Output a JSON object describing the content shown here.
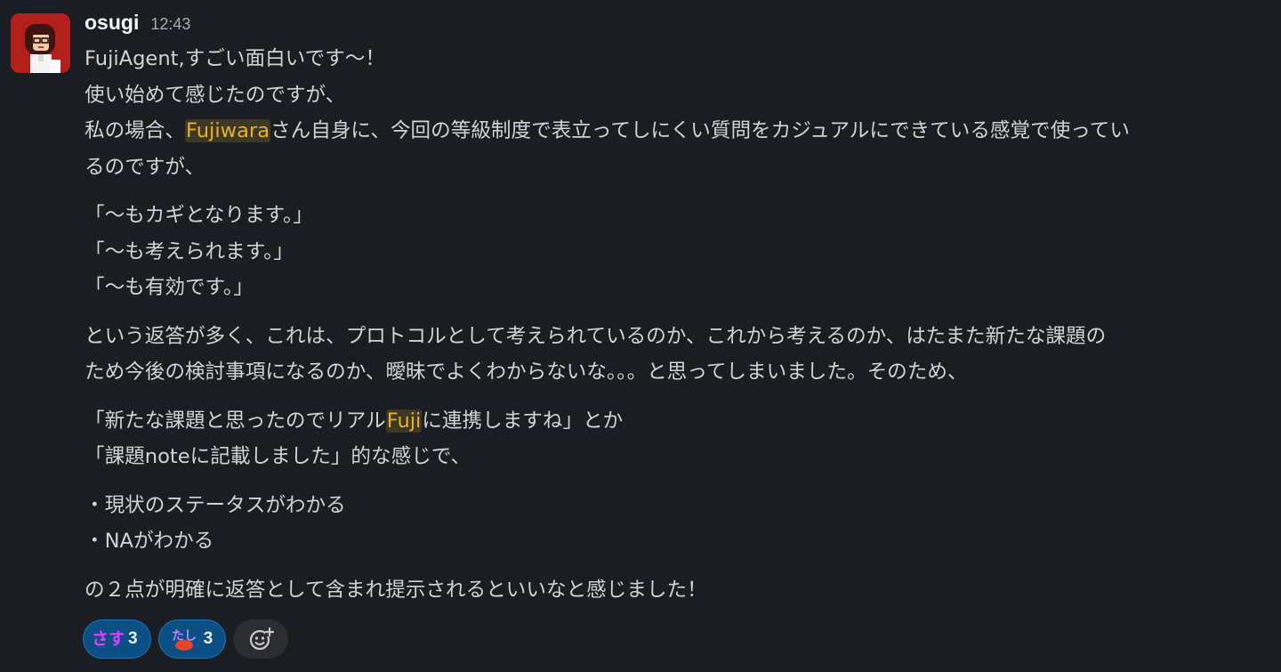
{
  "message": {
    "author": "osugi",
    "time": "12:43",
    "paragraphs": [
      [
        [
          {
            "t": "FujiAgent,すごい面白いです〜！"
          }
        ],
        [
          {
            "t": "使い始めて感じたのですが、"
          }
        ],
        [
          {
            "t": "私の場合、"
          },
          {
            "t": "Fujiwara",
            "mention": true
          },
          {
            "t": "さん自身に、今回の等級制度で表立ってしにくい質問をカジュアルにできている感覚で使ってい"
          }
        ],
        [
          {
            "t": "るのですが、"
          }
        ]
      ],
      [
        [
          {
            "t": "「〜もカギとなります。」"
          }
        ],
        [
          {
            "t": "「〜も考えられます。」"
          }
        ],
        [
          {
            "t": "「〜も有効です。」"
          }
        ]
      ],
      [
        [
          {
            "t": "という返答が多く、これは、プロトコルとして考えられているのか、これから考えるのか、はたまた新たな課題の"
          }
        ],
        [
          {
            "t": "ため今後の検討事項になるのか、曖昧でよくわからないな。。。と思ってしまいました。そのため、"
          }
        ]
      ],
      [
        [
          {
            "t": "「新たな課題と思ったのでリアル"
          },
          {
            "t": "Fuji",
            "mention": true
          },
          {
            "t": "に連携しますね」とか"
          }
        ],
        [
          {
            "t": "「課題noteに記載しました」的な感じで、"
          }
        ]
      ],
      [
        [
          {
            "t": "・現状のステータスがわかる"
          }
        ],
        [
          {
            "t": "・NAがわかる"
          }
        ]
      ],
      [
        [
          {
            "t": "の２点が明確に返答として含まれ提示されるといいなと感じました！"
          }
        ]
      ]
    ]
  },
  "reactions": [
    {
      "emoji": "さす",
      "icon": "sasu-emoji",
      "count": "3",
      "color": "#e040fb"
    },
    {
      "emoji": "たし",
      "icon": "tashi-crab-emoji",
      "count": "3",
      "color": "#c084fc"
    }
  ],
  "add_reaction": {
    "icon": "add-reaction-icon"
  },
  "colors": {
    "background": "#1a1d21",
    "text": "#d1d2d3",
    "mention": "#eab026",
    "reaction_bg": "#0b4f85",
    "avatar_bg": "#b3201c"
  }
}
